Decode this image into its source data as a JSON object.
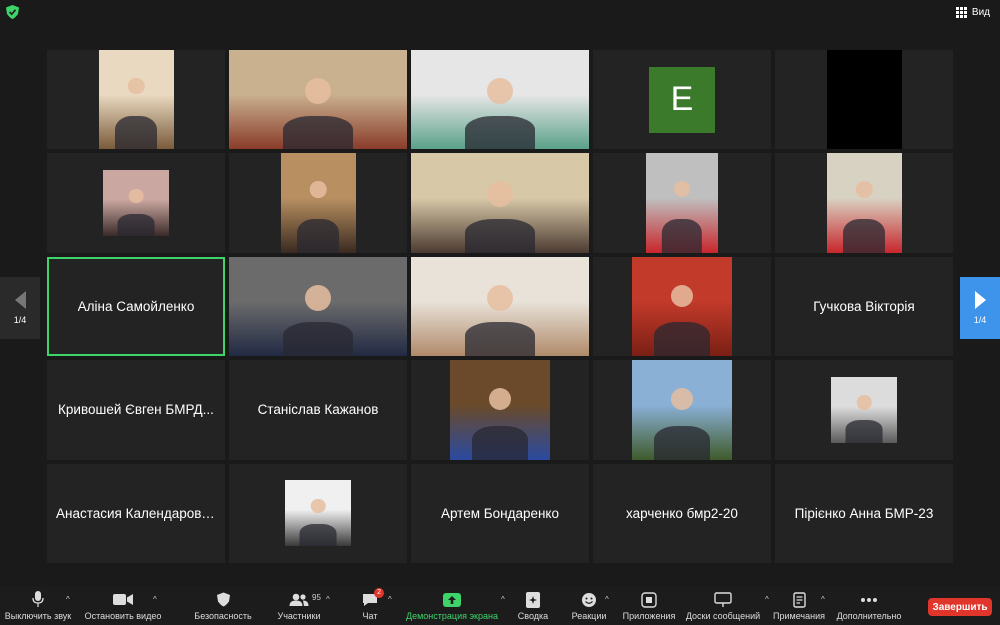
{
  "header": {
    "view_label": "Вид"
  },
  "pager": {
    "left_label": "1/4",
    "right_label": "1/4"
  },
  "tiles": [
    {
      "type": "video",
      "name": "participant-video-1",
      "width": "w75",
      "colors": [
        "#e9d9c0",
        "#7a5b3a"
      ]
    },
    {
      "type": "video",
      "name": "participant-video-2",
      "width": "w178",
      "colors": [
        "#c9b08f",
        "#8a3c2a"
      ]
    },
    {
      "type": "video",
      "name": "participant-video-3",
      "width": "w178",
      "colors": [
        "#e6e6e6",
        "#5aa18a"
      ]
    },
    {
      "type": "avatar",
      "letter": "E"
    },
    {
      "type": "black"
    },
    {
      "type": "video",
      "name": "participant-video-6",
      "width": "small",
      "colors": [
        "#caa7a0",
        "#3a2a2a"
      ]
    },
    {
      "type": "video",
      "name": "participant-video-7",
      "width": "w75",
      "colors": [
        "#b88f61",
        "#3a2a20"
      ]
    },
    {
      "type": "video",
      "name": "participant-video-8",
      "width": "w178",
      "colors": [
        "#d7c8a8",
        "#4b3a30"
      ]
    },
    {
      "type": "video",
      "name": "participant-video-9",
      "width": "w72",
      "colors": [
        "#bfbfbf",
        "#c8262c"
      ]
    },
    {
      "type": "video",
      "name": "participant-video-10",
      "width": "w75",
      "colors": [
        "#d8d2c2",
        "#c8262c"
      ]
    },
    {
      "type": "name",
      "label": "Аліна Самойленко",
      "active": true
    },
    {
      "type": "video",
      "name": "participant-video-12",
      "width": "w178",
      "colors": [
        "#6b6b6b",
        "#222a44"
      ]
    },
    {
      "type": "video",
      "name": "participant-video-13",
      "width": "w178",
      "colors": [
        "#e8e2d8",
        "#b08a6a"
      ]
    },
    {
      "type": "video",
      "name": "participant-video-14",
      "width": "w100",
      "colors": [
        "#c23a2a",
        "#7a1f14"
      ]
    },
    {
      "type": "name",
      "label": "Гучкова Вікторія"
    },
    {
      "type": "name",
      "label": "Кривошей Євген БМРД..."
    },
    {
      "type": "name",
      "label": "Станіслав Кажанов"
    },
    {
      "type": "video",
      "name": "participant-video-18",
      "width": "w100",
      "colors": [
        "#6a4a2a",
        "#2a4aa0"
      ]
    },
    {
      "type": "video",
      "name": "participant-video-19",
      "width": "w100",
      "colors": [
        "#8ab0d6",
        "#3f5a2a"
      ]
    },
    {
      "type": "video",
      "name": "participant-video-20",
      "width": "small",
      "colors": [
        "#dcdcdc",
        "#5a5a5a"
      ]
    },
    {
      "type": "name",
      "label": "Анастасия Календарова..."
    },
    {
      "type": "video",
      "name": "participant-video-22",
      "width": "small",
      "colors": [
        "#f0f0f0",
        "#3a3a3a"
      ]
    },
    {
      "type": "name",
      "label": "Артем Бондаренко"
    },
    {
      "type": "name",
      "label": "харченко бмр2-20"
    },
    {
      "type": "name",
      "label": "Пірієнко Анна БМР-23"
    }
  ],
  "toolbar": {
    "mute_label": "Выключить звук",
    "video_label": "Остановить видео",
    "security_label": "Безопасность",
    "participants_label": "Участники",
    "participants_count": "95",
    "chat_label": "Чат",
    "chat_badge": "2",
    "share_label": "Демонстрация экрана",
    "summary_label": "Сводка",
    "reactions_label": "Реакции",
    "apps_label": "Приложения",
    "whiteboards_label": "Доски сообщений",
    "notes_label": "Примечания",
    "more_label": "Дополнительно",
    "end_label": "Завершить"
  },
  "colors": {
    "accent_green": "#3fd46a",
    "end_red": "#e0352b",
    "pager_blue": "#3d94ea"
  }
}
